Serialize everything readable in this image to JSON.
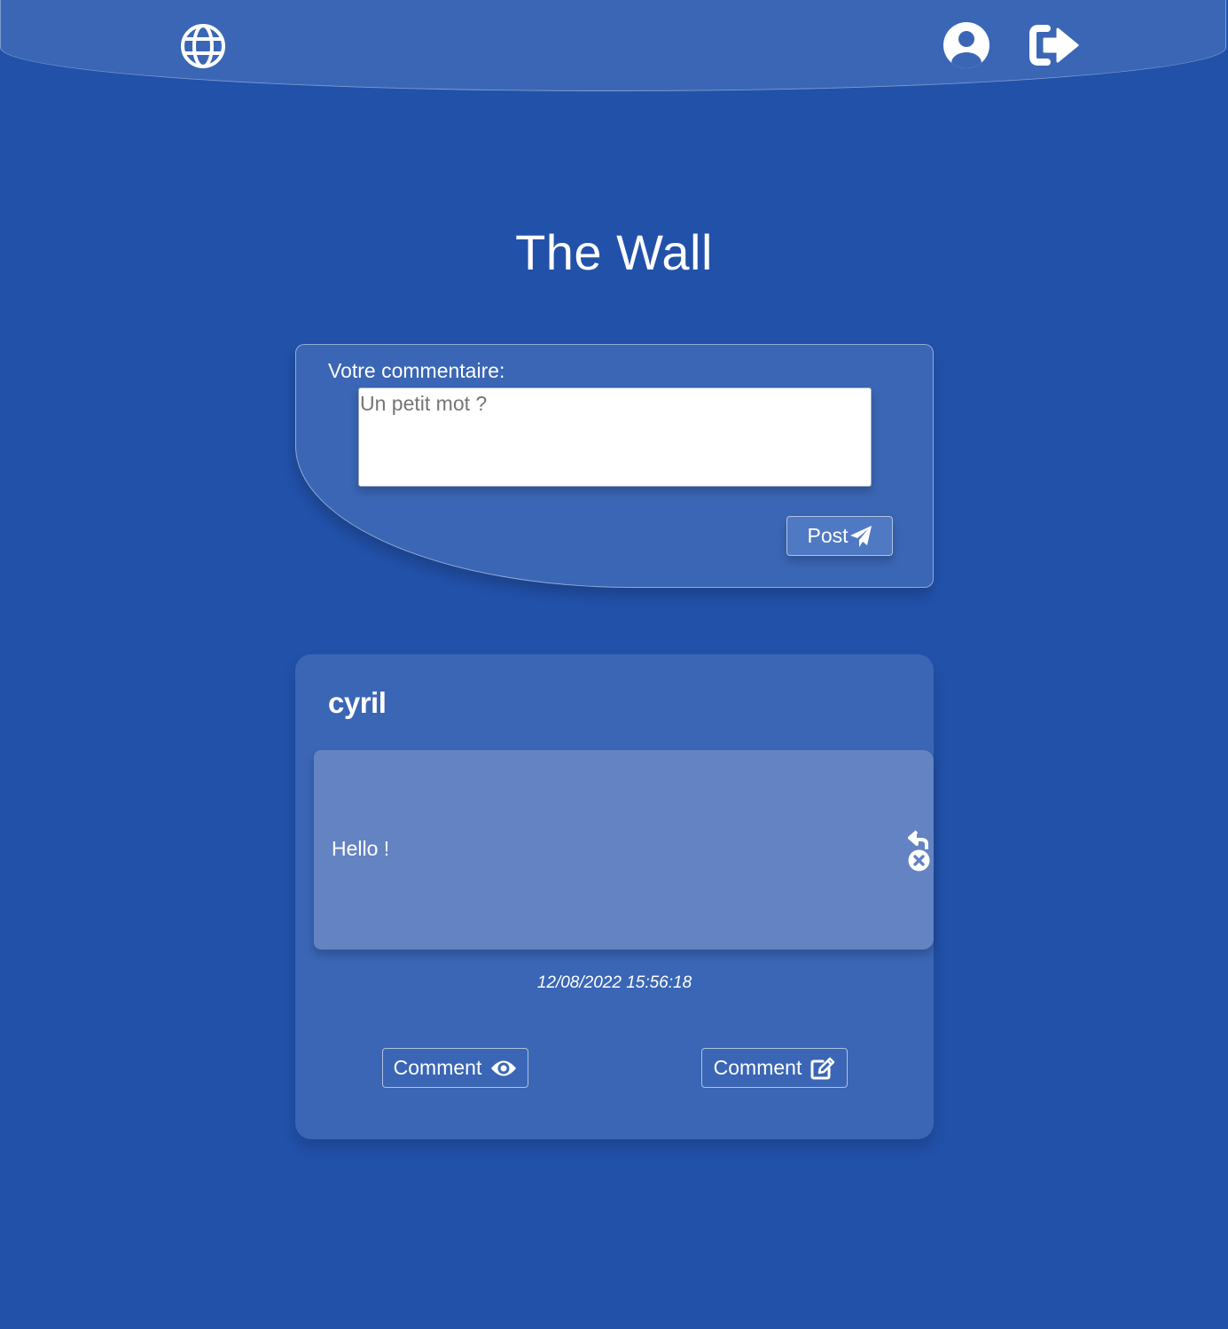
{
  "header": {
    "home_icon": "globe-icon",
    "profile_icon": "user-circle-icon",
    "logout_icon": "logout-icon"
  },
  "page": {
    "title": "The Wall"
  },
  "composer": {
    "label": "Votre commentaire:",
    "placeholder": "Un petit mot ?",
    "value": "",
    "post_label": "Post",
    "post_icon": "paper-plane-icon"
  },
  "posts": [
    {
      "author": "cyril",
      "message": "Hello !",
      "timestamp": "12/08/2022 15:56:18",
      "reply_icon": "reply-icon",
      "delete_icon": "close-circle-icon",
      "view_comments_label": "Comment",
      "view_comments_icon": "eye-icon",
      "write_comment_label": "Comment",
      "write_comment_icon": "edit-icon"
    }
  ],
  "colors": {
    "background": "#2251aa",
    "panel": "#3a66b5",
    "message_panel": "#6383c2",
    "text": "#ffffff"
  }
}
